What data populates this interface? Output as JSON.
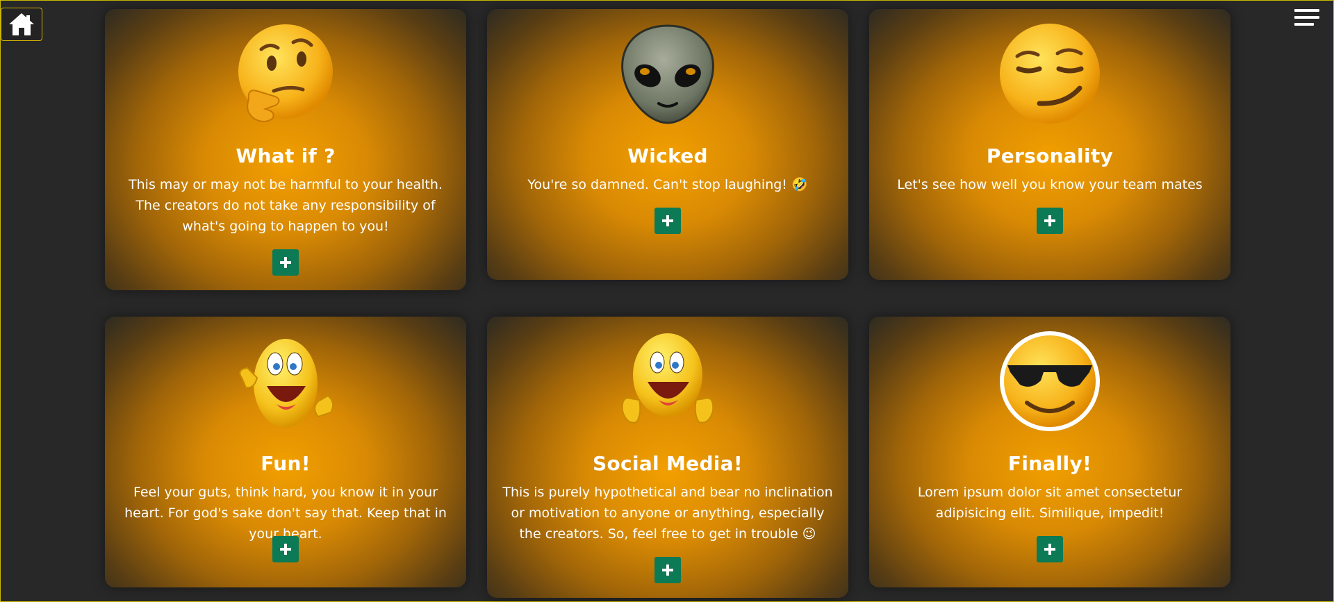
{
  "nav": {
    "home_icon": "home-icon",
    "menu_icon": "hamburger-menu-icon"
  },
  "cards": [
    {
      "title": "What if ?",
      "text": "This may or may not be harmful to your health. The creators do not take any responsibility of what's going to happen to you!",
      "emoji": "thinking-face",
      "button": "+"
    },
    {
      "title": "Wicked",
      "text": "You're so damned. Can't stop laughing! 🤣",
      "emoji": "alien",
      "button": "+"
    },
    {
      "title": "Personality",
      "text": "Let's see how well you know your team mates",
      "emoji": "smirking-face",
      "button": "+"
    },
    {
      "title": "Fun!",
      "text": "Feel your guts, think hard, you know it in your heart. For god's sake don't say that. Keep that in your heart.",
      "emoji": "pointing-smiley",
      "button": "+"
    },
    {
      "title": "Social Media!",
      "text": "This is purely hypothetical and bear no inclination or motivation to anyone or anything, especially the creators. So, feel free to get in trouble 😉",
      "emoji": "thumbs-up-smiley",
      "button": "+"
    },
    {
      "title": "Finally!",
      "text": "Lorem ipsum dolor sit amet consectetur adipisicing elit. Similique, impedit!",
      "emoji": "smiling-face-with-sunglasses",
      "button": "+"
    }
  ],
  "colors": {
    "background": "#282828",
    "card_glow": "#f29f00",
    "button": "#0b7a55",
    "home_border": "#d4b400"
  }
}
